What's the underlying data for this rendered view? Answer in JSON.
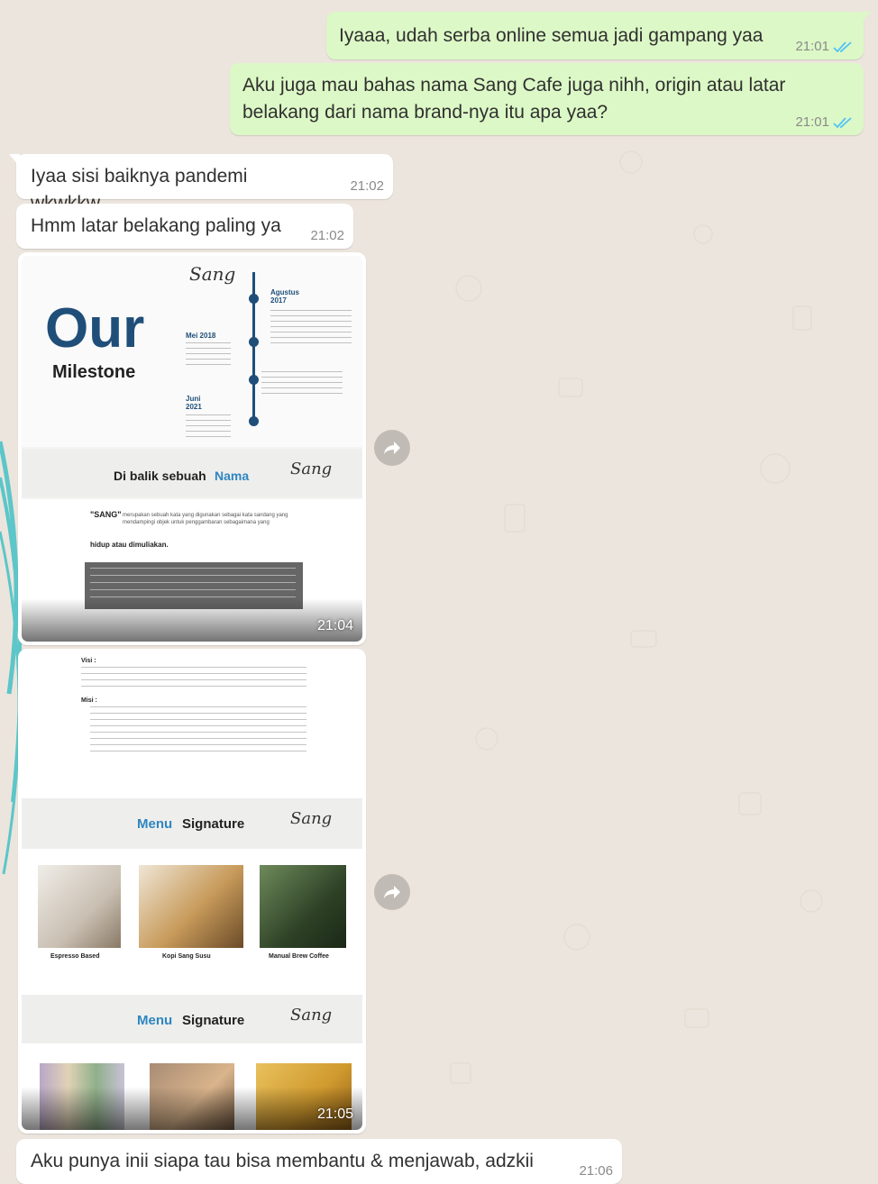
{
  "messages": [
    {
      "dir": "out",
      "text": "Iyaaa, udah serba online semua jadi gampang yaa",
      "time": "21:01"
    },
    {
      "dir": "out",
      "text": "Aku juga mau bahas nama Sang Cafe juga nihh, origin atau latar belakang dari nama brand-nya itu apa yaa?",
      "time": "21:01"
    },
    {
      "dir": "in",
      "text": "Iyaa sisi baiknya pandemi wkwkkw",
      "time": "21:02"
    },
    {
      "dir": "in",
      "text": "Hmm latar belakang paling ya",
      "time": "21:02"
    },
    {
      "dir": "in",
      "text": "Aku punya inii siapa tau bisa membantu & menjawab, adzkii",
      "time": "21:06"
    }
  ],
  "image1": {
    "time": "21:04",
    "our": "Our",
    "milestone": "Milestone",
    "agustus": "Agustus 2017",
    "mei": "Mei 2018",
    "juni": "Juni 2021",
    "di_balik": "Di balik sebuah",
    "nama": "Nama",
    "sang_head": "\"SANG\"",
    "sang_body": "merupakan sebuah kata yang digunakan sebagai kata sandang yang mendampingi objek untuk penggambaran sebagaimana yang",
    "hidup": "hidup atau dimuliakan."
  },
  "image2": {
    "time": "21:05",
    "menu1_a": "Menu",
    "menu1_b": "Signature",
    "menu2_a": "Menu",
    "menu2_b": "Signature",
    "item1": "Espresso Based",
    "item2": "Kopi Sang Susu",
    "item3": "Manual Brew Coffee",
    "visi": "Visi :",
    "misi": "Misi :"
  },
  "logo_text": "Sang",
  "icons": {
    "forward": "forward-icon",
    "ticks": "double-check-icon"
  },
  "colors": {
    "out": "#dcf8c6",
    "in": "#ffffff",
    "bg": "#ece5dd",
    "tick": "#4fc3f7",
    "brand": "#1f4e79"
  }
}
